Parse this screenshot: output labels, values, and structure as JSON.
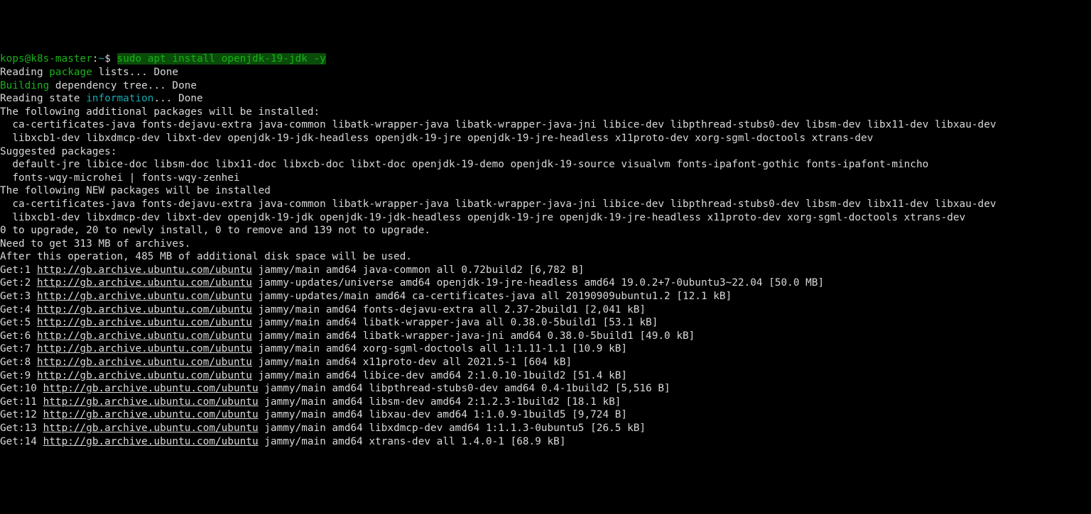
{
  "prompt": {
    "user": "kops@k8s-master",
    "sep": ":",
    "path": "~",
    "dollar": "$",
    "command": "sudo apt install openjdk-19-jdk -y"
  },
  "status": {
    "reading_lists": "Reading package lists... Done",
    "reading_lists_pre": "Reading",
    "reading_lists_hl": "package",
    "reading_lists_post": " lists... Done",
    "building_pre": "Building",
    "building_hl": " dependency",
    "building_post": " tree... Done",
    "state_pre": "Reading state ",
    "state_hl": "information",
    "state_post": "... Done"
  },
  "lines": {
    "l4": "The following additional packages will be installed:",
    "l5": "  ca-certificates-java fonts-dejavu-extra java-common libatk-wrapper-java libatk-wrapper-java-jni libice-dev libpthread-stubs0-dev libsm-dev libx11-dev libxau-dev",
    "l6": "  libxcb1-dev libxdmcp-dev libxt-dev openjdk-19-jdk-headless openjdk-19-jre openjdk-19-jre-headless x11proto-dev xorg-sgml-doctools xtrans-dev",
    "l7": "Suggested packages:",
    "l8": "  default-jre libice-doc libsm-doc libx11-doc libxcb-doc libxt-doc openjdk-19-demo openjdk-19-source visualvm fonts-ipafont-gothic fonts-ipafont-mincho",
    "l9": "  fonts-wqy-microhei | fonts-wqy-zenhei",
    "l10": "The following NEW packages will be installed",
    "l11": "  ca-certificates-java fonts-dejavu-extra java-common libatk-wrapper-java libatk-wrapper-java-jni libice-dev libpthread-stubs0-dev libsm-dev libx11-dev libxau-dev",
    "l12": "  libxcb1-dev libxdmcp-dev libxt-dev openjdk-19-jdk openjdk-19-jdk-headless openjdk-19-jre openjdk-19-jre-headless x11proto-dev xorg-sgml-doctools xtrans-dev",
    "l13": "0 to upgrade, 20 to newly install, 0 to remove and 139 not to upgrade.",
    "l14": "Need to get 313 MB of archives.",
    "l15": "After this operation, 485 MB of additional disk space will be used."
  },
  "gets": [
    {
      "n": "1",
      "url": "http://gb.archive.ubuntu.com/ubuntu",
      "rest": " jammy/main amd64 java-common all 0.72build2 [6,782 B]"
    },
    {
      "n": "2",
      "url": "http://gb.archive.ubuntu.com/ubuntu",
      "rest": " jammy-updates/universe amd64 openjdk-19-jre-headless amd64 19.0.2+7-0ubuntu3~22.04 [50.0 MB]"
    },
    {
      "n": "3",
      "url": "http://gb.archive.ubuntu.com/ubuntu",
      "rest": " jammy-updates/main amd64 ca-certificates-java all 20190909ubuntu1.2 [12.1 kB]"
    },
    {
      "n": "4",
      "url": "http://gb.archive.ubuntu.com/ubuntu",
      "rest": " jammy/main amd64 fonts-dejavu-extra all 2.37-2build1 [2,041 kB]"
    },
    {
      "n": "5",
      "url": "http://gb.archive.ubuntu.com/ubuntu",
      "rest": " jammy/main amd64 libatk-wrapper-java all 0.38.0-5build1 [53.1 kB]"
    },
    {
      "n": "6",
      "url": "http://gb.archive.ubuntu.com/ubuntu",
      "rest": " jammy/main amd64 libatk-wrapper-java-jni amd64 0.38.0-5build1 [49.0 kB]"
    },
    {
      "n": "7",
      "url": "http://gb.archive.ubuntu.com/ubuntu",
      "rest": " jammy/main amd64 xorg-sgml-doctools all 1:1.11-1.1 [10.9 kB]"
    },
    {
      "n": "8",
      "url": "http://gb.archive.ubuntu.com/ubuntu",
      "rest": " jammy/main amd64 x11proto-dev all 2021.5-1 [604 kB]"
    },
    {
      "n": "9",
      "url": "http://gb.archive.ubuntu.com/ubuntu",
      "rest": " jammy/main amd64 libice-dev amd64 2:1.0.10-1build2 [51.4 kB]"
    },
    {
      "n": "10",
      "url": "http://gb.archive.ubuntu.com/ubuntu",
      "rest": " jammy/main amd64 libpthread-stubs0-dev amd64 0.4-1build2 [5,516 B]"
    },
    {
      "n": "11",
      "url": "http://gb.archive.ubuntu.com/ubuntu",
      "rest": " jammy/main amd64 libsm-dev amd64 2:1.2.3-1build2 [18.1 kB]"
    },
    {
      "n": "12",
      "url": "http://gb.archive.ubuntu.com/ubuntu",
      "rest": " jammy/main amd64 libxau-dev amd64 1:1.0.9-1build5 [9,724 B]"
    },
    {
      "n": "13",
      "url": "http://gb.archive.ubuntu.com/ubuntu",
      "rest": " jammy/main amd64 libxdmcp-dev amd64 1:1.1.3-0ubuntu5 [26.5 kB]"
    },
    {
      "n": "14",
      "url": "http://gb.archive.ubuntu.com/ubuntu",
      "rest": " jammy/main amd64 xtrans-dev all 1.4.0-1 [68.9 kB]"
    }
  ]
}
